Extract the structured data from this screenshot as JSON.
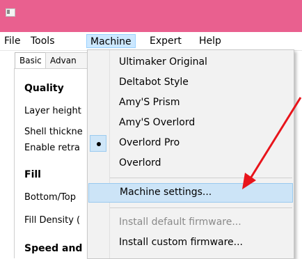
{
  "menubar": [
    "File",
    "Tools",
    "Machine",
    "Expert",
    "Help"
  ],
  "tabs": [
    "Basic",
    "Advan"
  ],
  "settings": {
    "quality_heading": "Quality",
    "layer_height": "Layer height",
    "shell_thickness": "Shell thickne",
    "enable_retraction": "Enable retra",
    "fill_heading": "Fill",
    "bottom_top": "Bottom/Top",
    "fill_density": "Fill Density (",
    "speed_heading": "Speed and"
  },
  "machine_menu": {
    "items": [
      "Ultimaker Original",
      "Deltabot Style",
      "Amy'S Prism",
      "Amy'S Overlord",
      "Overlord Pro",
      "Overlord"
    ],
    "selected": "Overlord Pro",
    "machine_settings": "Machine settings...",
    "install_default": "Install default firmware...",
    "install_custom": "Install custom firmware..."
  },
  "colors": {
    "titlebar": "#e9608f",
    "arrow": "#e8141b",
    "highlight": "#cce4f7"
  }
}
